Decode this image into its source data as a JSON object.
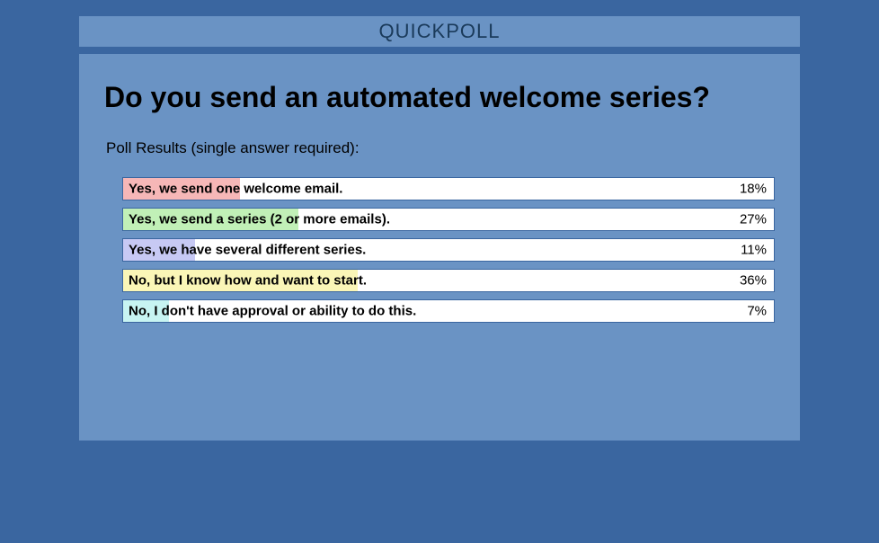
{
  "header": {
    "title": "QUICKPOLL"
  },
  "poll": {
    "question": "Do you send an automated welcome series?",
    "subtitle": "Poll Results (single answer required):",
    "options": [
      {
        "label": "Yes, we send one welcome email.",
        "pct": "18%",
        "value": 18,
        "color": "#f6b7b7"
      },
      {
        "label": "Yes, we send a series (2 or more emails).",
        "pct": "27%",
        "value": 27,
        "color": "#c1f0b7"
      },
      {
        "label": "Yes, we have several different series.",
        "pct": "11%",
        "value": 11,
        "color": "#c7c9f4"
      },
      {
        "label": "No, but I know how and want to start.",
        "pct": "36%",
        "value": 36,
        "color": "#faf6b7"
      },
      {
        "label": "No, I don't have approval or ability to do this.",
        "pct": "7%",
        "value": 7,
        "color": "#c7f4f2"
      }
    ]
  },
  "chart_data": {
    "type": "bar",
    "title": "Do you send an automated welcome series?",
    "subtitle": "Poll Results (single answer required)",
    "xlabel": "",
    "ylabel": "",
    "categories": [
      "Yes, we send one welcome email.",
      "Yes, we send a series (2 or more emails).",
      "Yes, we have several different series.",
      "No, but I know how and want to start.",
      "No, I don't have approval or ability to do this."
    ],
    "values": [
      18,
      27,
      11,
      36,
      7
    ],
    "unit": "%",
    "xlim": [
      0,
      100
    ]
  }
}
